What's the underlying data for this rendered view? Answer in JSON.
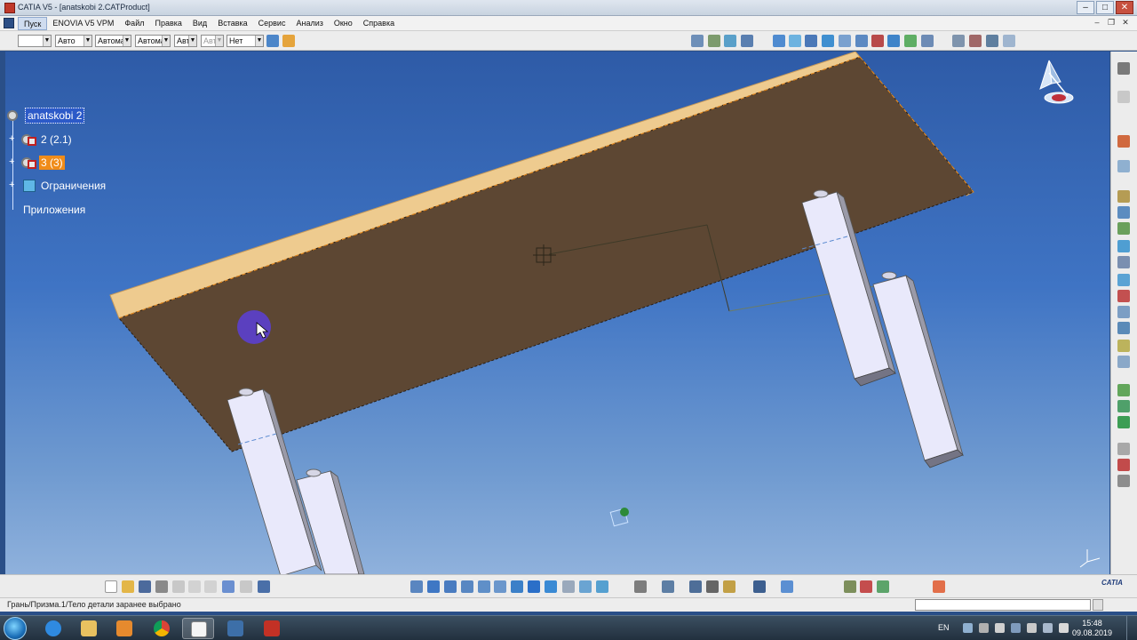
{
  "window": {
    "title": "CATIA V5 - [anatskobi 2.CATProduct]",
    "controls": {
      "minimize": "–",
      "maximize": "□",
      "close": "✕"
    }
  },
  "menu": {
    "items": [
      "Пуск",
      "ENOVIA V5 VPM",
      "Файл",
      "Правка",
      "Вид",
      "Вставка",
      "Сервис",
      "Анализ",
      "Окно",
      "Справка"
    ],
    "doc_controls": {
      "minimize": "–",
      "restore": "❐",
      "close": "✕"
    }
  },
  "style_toolbar": {
    "combos": [
      {
        "value": ""
      },
      {
        "value": "Авто"
      },
      {
        "value": "Автомат"
      },
      {
        "value": "Автомат"
      },
      {
        "value": "Авто"
      },
      {
        "value": "Авто"
      },
      {
        "value": "Нет"
      }
    ]
  },
  "spec_tree": {
    "root": "anatskobi 2",
    "children": [
      {
        "label": "2 (2.1)"
      },
      {
        "label": "3 (3)"
      },
      {
        "label": "Ограничения"
      },
      {
        "label": "Приложения"
      }
    ]
  },
  "status_bar": {
    "message": "Грань/Призма.1/Тело детали заранее выбрано"
  },
  "taskbar": {
    "language": "EN",
    "time": "15:48",
    "date": "09.08.2019"
  },
  "brand": {
    "logo_text": "CATIA"
  },
  "colors": {
    "viewport_top": "#2e5ba7",
    "board_face": "#5d4733",
    "board_edge": "#eecb8f",
    "leg_face": "#e9e9fb",
    "leg_side": "#9a9aa8",
    "cursor_halo": "#5a3fd8",
    "selection_highlight": "#f08c19"
  },
  "icons": {
    "compass": "compass-icon",
    "axis_triad": "axis-triad-icon",
    "cursor": "hand-cursor-icon"
  }
}
